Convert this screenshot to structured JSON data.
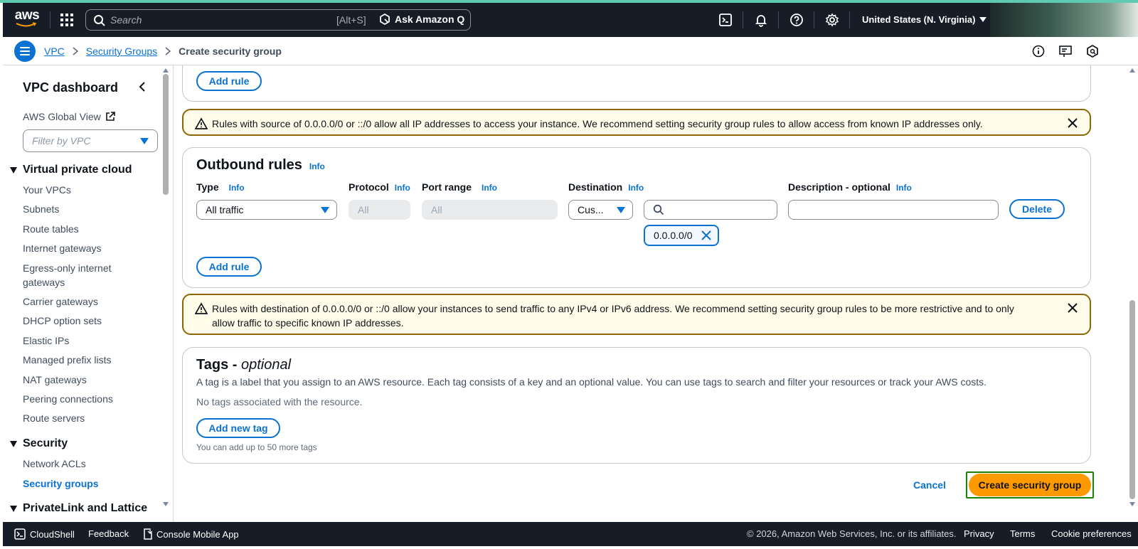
{
  "topnav": {
    "logo_text": "aws",
    "search_placeholder": "Search",
    "search_shortcut": "[Alt+S]",
    "ask_q_label": "Ask Amazon Q",
    "region_label": "United States (N. Virginia)",
    "icons": [
      "cloudshell-icon",
      "bell-icon",
      "help-icon",
      "gear-icon"
    ]
  },
  "breadcrumb": {
    "items": [
      "VPC",
      "Security Groups"
    ],
    "current": "Create security group"
  },
  "sidebar": {
    "title": "VPC dashboard",
    "global_view": "AWS Global View",
    "filter_placeholder": "Filter by VPC",
    "sections": [
      {
        "title": "Virtual private cloud",
        "items": [
          "Your VPCs",
          "Subnets",
          "Route tables",
          "Internet gateways",
          "Egress-only internet gateways",
          "Carrier gateways",
          "DHCP option sets",
          "Elastic IPs",
          "Managed prefix lists",
          "NAT gateways",
          "Peering connections",
          "Route servers"
        ]
      },
      {
        "title": "Security",
        "items": [
          "Network ACLs",
          "Security groups"
        ]
      },
      {
        "title": "PrivateLink and Lattice",
        "items": []
      }
    ],
    "active_item": "Security groups"
  },
  "inbound": {
    "add_rule_label": "Add rule",
    "warning": "Rules with source of 0.0.0.0/0 or ::/0 allow all IP addresses to access your instance. We recommend setting security group rules to allow access from known IP addresses only."
  },
  "outbound": {
    "title": "Outbound rules",
    "info": "Info",
    "columns": {
      "type": "Type",
      "protocol": "Protocol",
      "port_range": "Port range",
      "destination": "Destination",
      "description": "Description - optional"
    },
    "row": {
      "type_value": "All traffic",
      "protocol_value": "All",
      "port_range_value": "All",
      "destination_type": "Cus...",
      "destination_search": "",
      "destination_token": "0.0.0.0/0",
      "description_value": "",
      "delete_label": "Delete"
    },
    "add_rule_label": "Add rule",
    "warning_line1": "Rules with destination of 0.0.0.0/0 or ::/0 allow your instances to send traffic to any IPv4 or IPv6 address. We recommend setting security group rules to be more restrictive and to only",
    "warning_line2": "allow traffic to specific known IP addresses."
  },
  "tags": {
    "title": "Tags - ",
    "title_optional": "optional",
    "description": "A tag is a label that you assign to an AWS resource. Each tag consists of a key and an optional value. You can use tags to search and filter your resources or track your AWS costs.",
    "empty_text": "No tags associated with the resource.",
    "add_tag_label": "Add new tag",
    "limit_text": "You can add up to 50 more tags"
  },
  "actions": {
    "cancel_label": "Cancel",
    "create_label": "Create security group"
  },
  "footer": {
    "cloudshell": "CloudShell",
    "feedback": "Feedback",
    "mobile_app": "Console Mobile App",
    "copyright": "© 2026, Amazon Web Services, Inc. or its affiliates.",
    "privacy": "Privacy",
    "terms": "Terms",
    "cookies": "Cookie preferences"
  },
  "colors": {
    "accent": "#0972d3",
    "nav_bg": "#161d26",
    "primary_button": "#ff9900",
    "warning_border": "#8d6605",
    "warning_bg": "#fffce9",
    "focus": "#1d8102"
  }
}
